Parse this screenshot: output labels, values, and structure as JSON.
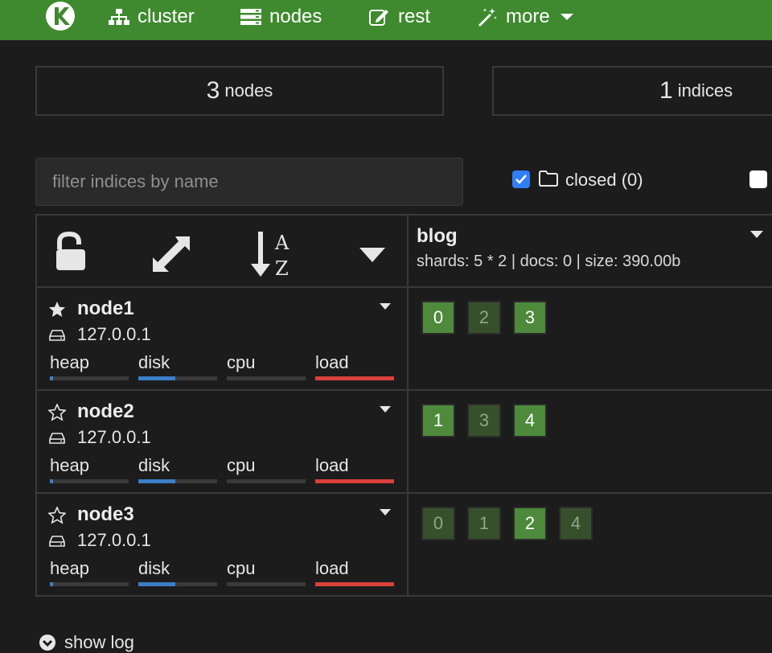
{
  "nav": {
    "cluster_label": "cluster",
    "nodes_label": "nodes",
    "rest_label": "rest",
    "more_label": "more"
  },
  "stats": {
    "nodes_count": "3",
    "nodes_label": "nodes",
    "indices_count": "1",
    "indices_label": "indices"
  },
  "filter": {
    "placeholder": "filter indices by name"
  },
  "closed_toggle": {
    "label": "closed (0)",
    "checked": true
  },
  "index": {
    "name": "blog",
    "info": "shards: 5 * 2 | docs: 0 | size: 390.00b"
  },
  "metric_labels": {
    "heap": "heap",
    "disk": "disk",
    "cpu": "cpu",
    "load": "load"
  },
  "nodes": [
    {
      "name": "node1",
      "ip": "127.0.0.1",
      "master": true,
      "metrics": {
        "heap": 0.04,
        "disk": 0.47,
        "cpu": 0.0,
        "load": 1.0
      },
      "shards": [
        {
          "n": "0",
          "type": "primary"
        },
        {
          "n": "2",
          "type": "replica"
        },
        {
          "n": "3",
          "type": "primary"
        }
      ]
    },
    {
      "name": "node2",
      "ip": "127.0.0.1",
      "master": false,
      "metrics": {
        "heap": 0.04,
        "disk": 0.47,
        "cpu": 0.0,
        "load": 1.0
      },
      "shards": [
        {
          "n": "1",
          "type": "primary"
        },
        {
          "n": "3",
          "type": "replica"
        },
        {
          "n": "4",
          "type": "primary"
        }
      ]
    },
    {
      "name": "node3",
      "ip": "127.0.0.1",
      "master": false,
      "metrics": {
        "heap": 0.04,
        "disk": 0.47,
        "cpu": 0.0,
        "load": 1.0
      },
      "shards": [
        {
          "n": "0",
          "type": "replica"
        },
        {
          "n": "1",
          "type": "replica"
        },
        {
          "n": "2",
          "type": "primary"
        },
        {
          "n": "4",
          "type": "replica"
        }
      ]
    }
  ],
  "show_log_label": "show log",
  "colors": {
    "navbar": "#3f8a2f",
    "primary_shard": "#4e8a3c",
    "replica_shard": "#36502c",
    "disk_bar": "#3a7fc8",
    "load_bar": "#d9403a",
    "heap_bar": "#3a7fc8"
  },
  "icons": {
    "logo": "kopf-logo-icon",
    "cluster": "sitemap-icon",
    "nodes": "server-icon",
    "rest": "edit-icon",
    "more": "magic-wand-icon",
    "unlock": "unlock-icon",
    "expand": "expand-icon",
    "sort": "sort-alpha-icon",
    "dropdown": "caret-down-icon",
    "folder": "folder-icon",
    "star": "star-icon",
    "hdd": "hdd-icon",
    "chevron": "chevron-down-circle-icon"
  }
}
